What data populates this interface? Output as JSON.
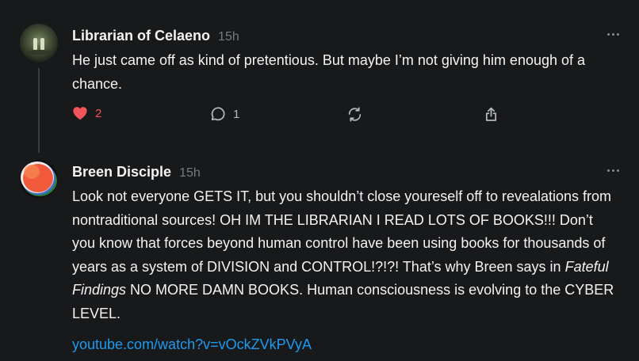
{
  "colors": {
    "background": "#18191b",
    "text": "#f3f3f3",
    "muted": "#777a80",
    "like": "#f1555b",
    "link": "#1d9bf0"
  },
  "posts": [
    {
      "author": "Librarian of Celaeno",
      "time": "15h",
      "avatar": "librarian-avatar",
      "text": "He just came off as kind of pretentious. But maybe I’m not giving him enough of a chance.",
      "likes": "2",
      "replies": "1",
      "liked": true,
      "icons": [
        "heart-icon",
        "reply-icon",
        "repost-icon",
        "share-icon",
        "more-icon"
      ]
    },
    {
      "author": "Breen Disciple",
      "time": "15h",
      "avatar": "breen-avatar",
      "text_before": "Look not everyone GETS IT, but you shouldn’t close youreself off to revealations from nontraditional sources! OH IM THE LIBRARIAN I READ LOTS OF BOOKS!!! Don’t you know that forces beyond human control have been using books for thousands of years as a system of DIVISION and CONTROL!?!?! That’s why Breen says in ",
      "text_emph": "Fateful Findings",
      "text_after": " NO MORE DAMN BOOKS. Human consciousness is evolving to the CYBER LEVEL.",
      "link": "youtube.com/watch?v=vOckZVkPVyA",
      "icons": [
        "more-icon"
      ]
    }
  ]
}
